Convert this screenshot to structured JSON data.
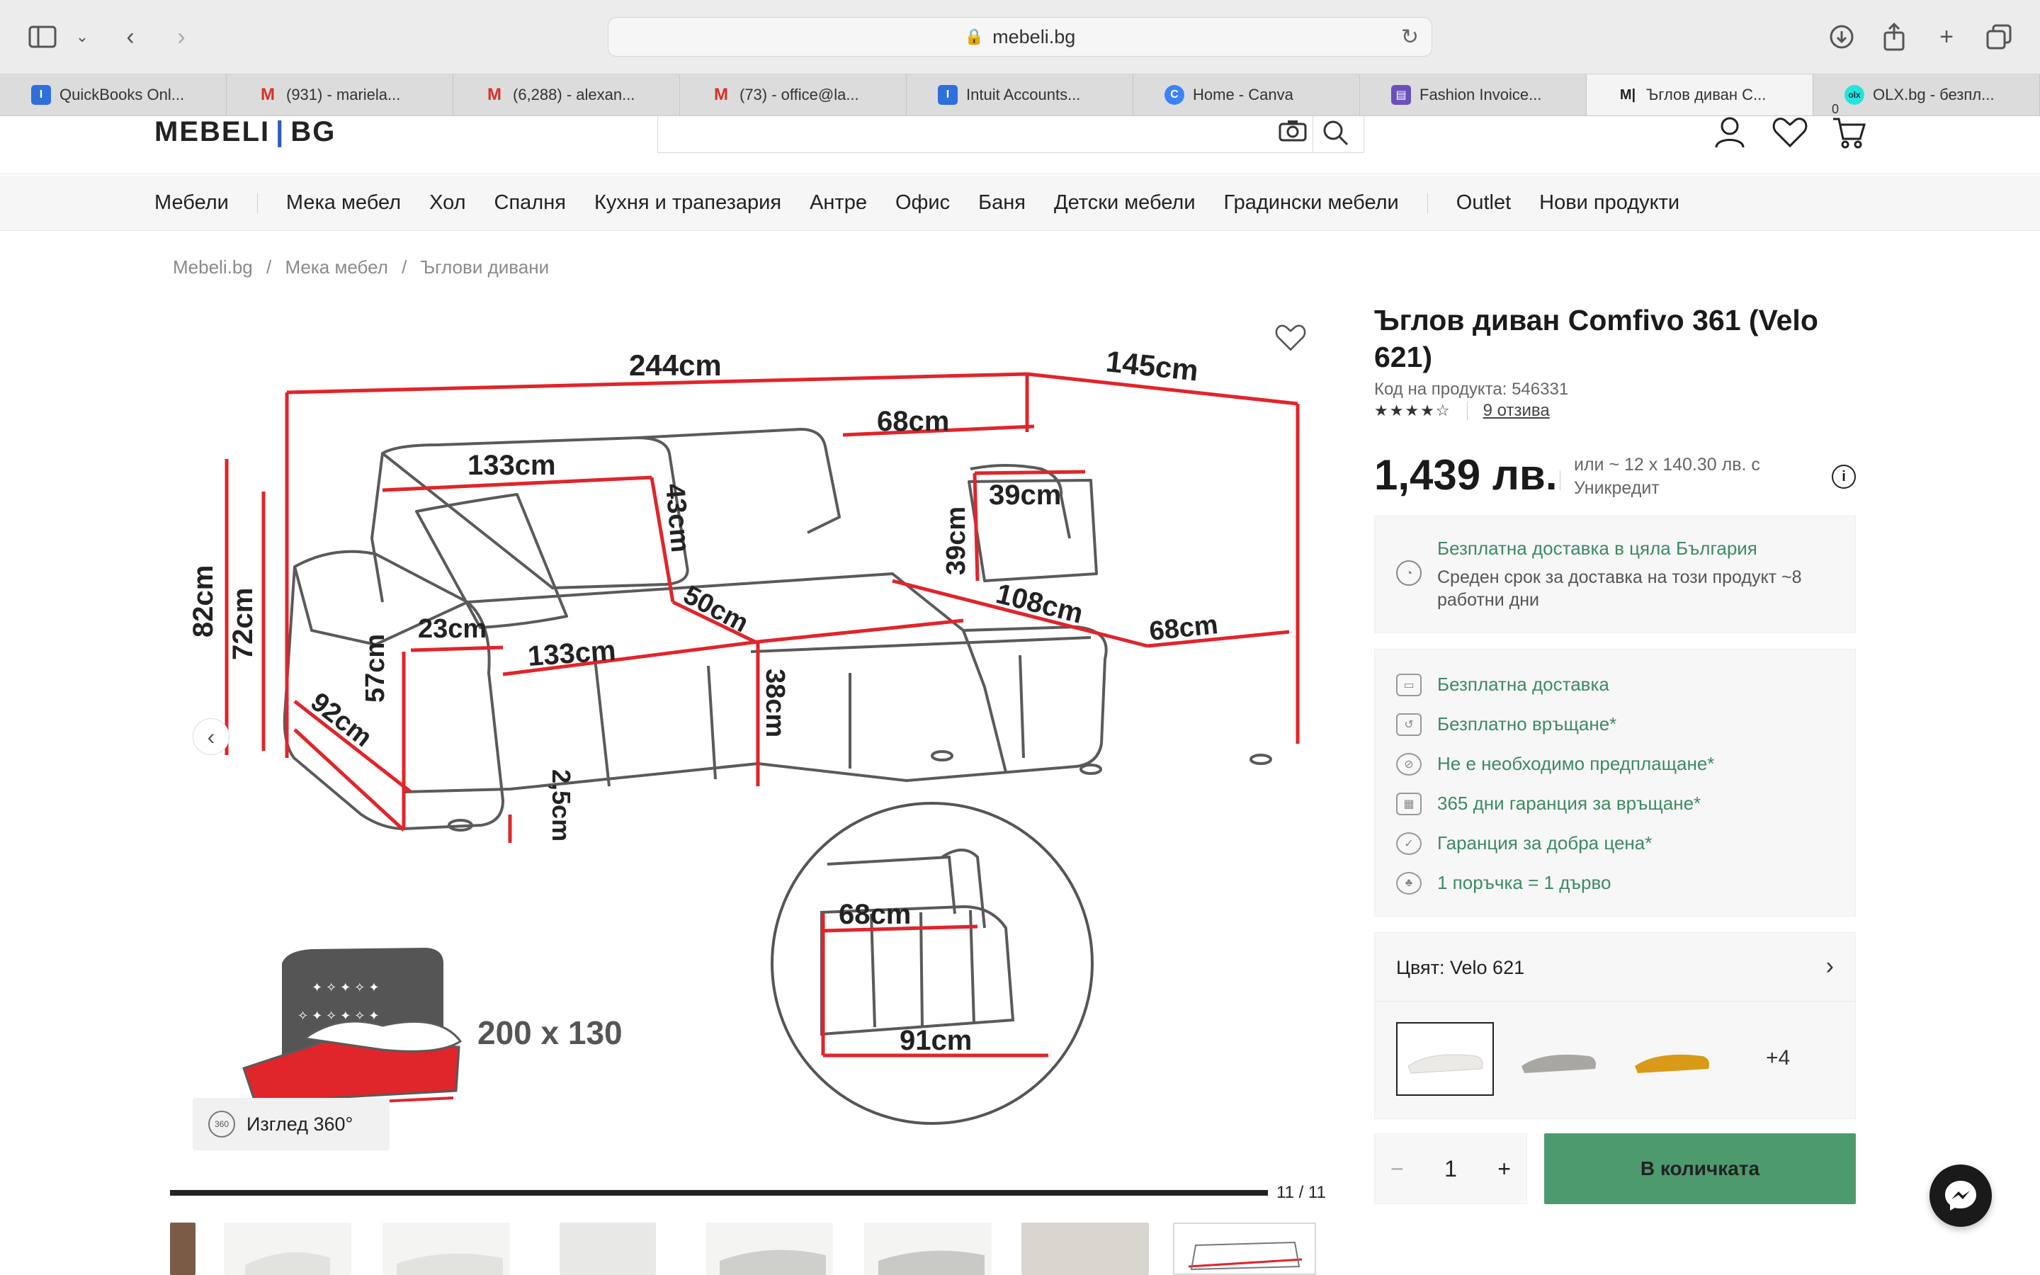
{
  "browser": {
    "url": "mebeli.bg",
    "tabs": [
      {
        "label": "QuickBooks Onl...",
        "icon": "quickbooks-icon",
        "color": "#2f6fdb"
      },
      {
        "label": "(931) - mariela...",
        "icon": "gmail-icon",
        "color": "#d93025"
      },
      {
        "label": "(6,288) - alexan...",
        "icon": "gmail-icon",
        "color": "#d93025"
      },
      {
        "label": "(73) - office@la...",
        "icon": "gmail-icon",
        "color": "#d93025"
      },
      {
        "label": "Intuit Accounts...",
        "icon": "intuit-icon",
        "color": "#2f6fdb"
      },
      {
        "label": "Home - Canva",
        "icon": "canva-icon",
        "color": "#3b82f6"
      },
      {
        "label": "Fashion Invoice...",
        "icon": "invoice-icon",
        "color": "#6b4fbb"
      },
      {
        "label": "Ъглов диван С...",
        "icon": "mebeli-icon",
        "color": "#222222"
      },
      {
        "label": "OLX.bg - безпл...",
        "icon": "olx-icon",
        "color": "#23e5db"
      }
    ]
  },
  "site": {
    "logo_left": "MEBELI",
    "logo_sep": "|",
    "logo_right": "BG",
    "cart_count": "0",
    "nav": [
      "Мебели",
      "Мека мебел",
      "Хол",
      "Спалня",
      "Кухня и трапезария",
      "Антре",
      "Офис",
      "Баня",
      "Детски мебели",
      "Градински мебели",
      "Outlet",
      "Нови продукти"
    ]
  },
  "breadcrumb": [
    "Mebeli.bg",
    "/",
    "Мека мебел",
    "/",
    "Ъглови дивани"
  ],
  "gallery": {
    "view360_label": "Изглед 360°",
    "counter": "11 / 11",
    "progress": 1.0,
    "dims": {
      "d244": "244cm",
      "d145": "145cm",
      "d68top": "68cm",
      "d133top": "133cm",
      "d82": "82cm",
      "d72": "72cm",
      "d43": "43cm",
      "d39v": "39cm",
      "d39h": "39cm",
      "d23": "23cm",
      "d57": "57cm",
      "d133seat": "133cm",
      "d50": "50cm",
      "d108": "108cm",
      "d68seat": "68cm",
      "d92": "92cm",
      "d38": "38cm",
      "d25": "2,5cm",
      "d68circle": "68cm",
      "d91": "91cm",
      "bed": "200 x 130"
    }
  },
  "product": {
    "title": "Ъглов диван Comfivo 361 (Velo 621)",
    "code": "Код на продукта: 546331",
    "stars": "★★★★☆",
    "rating": 4,
    "reviews": "9 отзива",
    "price": "1,439 лв.",
    "installment": "или ~ 12 x 140.30 лв. с Уникредит",
    "delivery_title": "Безплатна доставка в цяла България",
    "delivery_text": "Среден срок за доставка на този продукт ~8 работни дни",
    "benefits": [
      "Безплатна доставка",
      "Безплатно връщане*",
      "Не е необходимо предплащане*",
      "365 дни гаранция за връщане*",
      "Гаранция за добра цена*",
      "1 поръчка = 1 дърво"
    ],
    "color_label": "Цвят: Velo 621",
    "more_colors": "+4",
    "qty": "1",
    "minus": "−",
    "plus": "+",
    "add_to_cart": "В количката"
  },
  "colors": {
    "accent_green": "#4e9a6f",
    "text_green": "#3d8a62",
    "dimension_red": "#e0252b"
  }
}
